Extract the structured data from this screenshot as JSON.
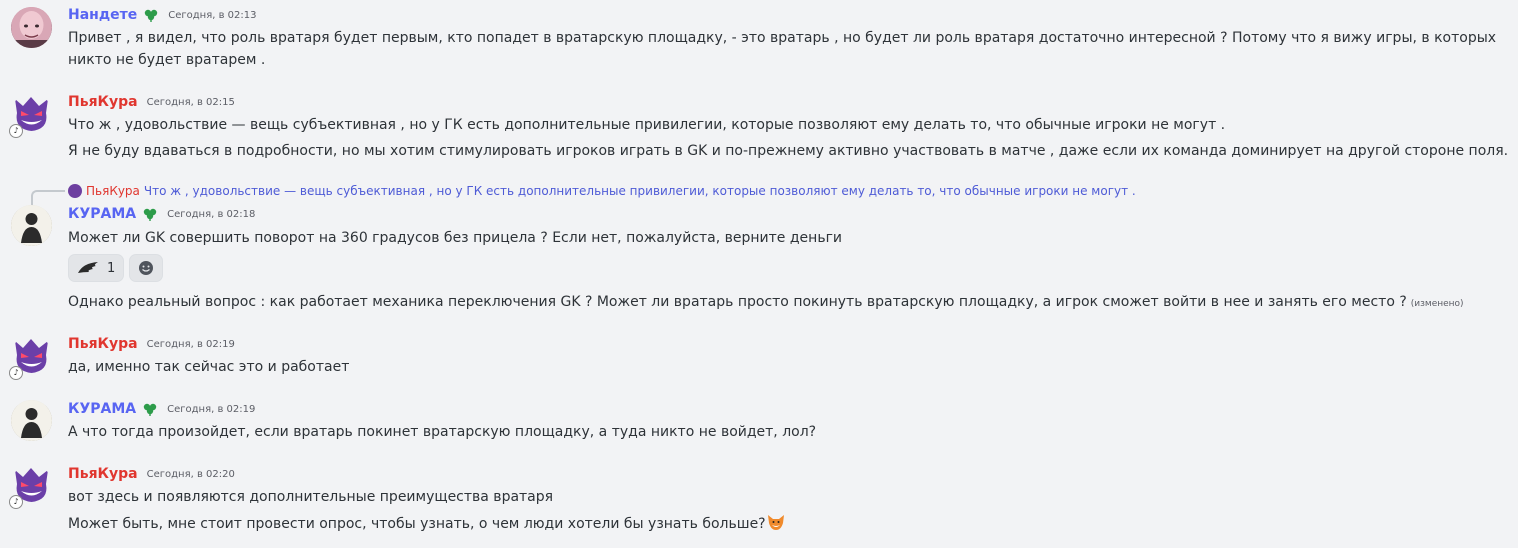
{
  "messages": [
    {
      "author": "Нандете",
      "timestamp": "Сегодня, в 02:13",
      "lines": [
        "Привет , я видел, что роль вратаря будет первым, кто попадет в вратарскую площадку, - это вратарь , но будет ли роль вратаря достаточно интересной ? Потому что я вижу игры, в которых никто не будет вратарем ."
      ]
    },
    {
      "author": "ПьяКура",
      "timestamp": "Сегодня, в 02:15",
      "lines": [
        "Что ж , удовольствие — вещь субъективная , но у ГК есть дополнительные привилегии, которые позволяют ему делать то, что обычные игроки не могут .",
        "Я не буду вдаваться в подробности, но мы хотим стимулировать игроков играть в GK и по-прежнему активно участвовать в матче , даже если их команда доминирует на другой стороне поля."
      ]
    },
    {
      "reply": {
        "author": "ПьяКура",
        "text": "Что ж , удовольствие — вещь субъективная , но у ГК есть дополнительные привилегии, которые позволяют ему делать то, что обычные игроки не могут ."
      },
      "author": "КУРАМА",
      "timestamp": "Сегодня, в 02:18",
      "lines": [
        "Может ли GK совершить поворот на 360 градусов без прицела ? Если нет, пожалуйста, верните деньги",
        "Однако реальный вопрос : как работает механика переключения GK ? Может ли вратарь просто покинуть вратарскую площадку, а игрок сможет войти в нее и занять его место ?"
      ],
      "edited_label": "(изменено)",
      "reactions": [
        {
          "emoji": "wing-emoji",
          "count": "1"
        }
      ]
    },
    {
      "author": "ПьяКура",
      "timestamp": "Сегодня, в 02:19",
      "lines": [
        "да, именно так сейчас это и работает"
      ]
    },
    {
      "author": "КУРАМА",
      "timestamp": "Сегодня, в 02:19",
      "lines": [
        "А что тогда произойдет, если вратарь покинет вратарскую площадку, а туда никто не войдет, лол?"
      ]
    },
    {
      "author": "ПьяКура",
      "timestamp": "Сегодня, в 02:20",
      "lines": [
        "вот здесь и появляются дополнительные преимущества вратаря",
        "Может быть, мне стоит провести опрос, чтобы узнать, о чем люди хотели бы узнать больше?"
      ],
      "trailing_emoji": "fox-emoji"
    }
  ],
  "colors": {
    "background": "#f2f3f5",
    "name_blue": "#5865f2",
    "name_red": "#e0362f",
    "clover_green": "#2d9c4a",
    "reply_text": "#4e5bd6"
  },
  "icons": {
    "clover_badge": "clover-icon",
    "add_reaction": "smiley-icon"
  }
}
